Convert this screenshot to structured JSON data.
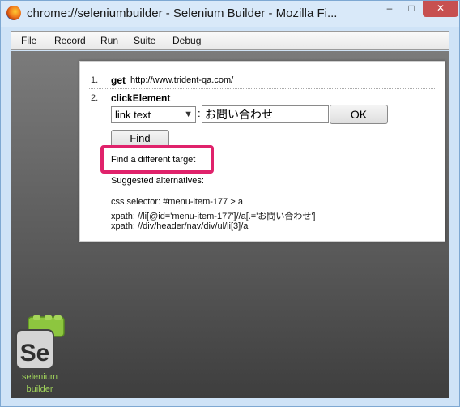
{
  "window": {
    "title": "chrome://seleniumbuilder - Selenium Builder - Mozilla Fi...",
    "controls": {
      "minimize": "–",
      "maximize": "□",
      "close": "✕"
    }
  },
  "menu": [
    "File",
    "Record",
    "Run",
    "Suite",
    "Debug"
  ],
  "steps": [
    {
      "num": "1.",
      "command": "get",
      "arg": "http://www.trident-qa.com/"
    },
    {
      "num": "2.",
      "command": "clickElement"
    }
  ],
  "locator": {
    "type_selected": "link text",
    "value": "お問い合わせ",
    "colon": ":",
    "ok_label": "OK",
    "find_label": "Find",
    "different_target_label": "Find a different target",
    "suggested_heading": "Suggested alternatives:",
    "alternatives": [
      "css selector: #menu-item-177 > a",
      "xpath: //li[@id='menu-item-177']//a[.='お問い合わせ']",
      "xpath: //div/header/nav/div/ul/li[3]/a"
    ]
  },
  "app": {
    "logo_text": "Se",
    "caption_line1": "selenium",
    "caption_line2": "builder"
  },
  "colors": {
    "highlight": "#e0226b",
    "accent_green": "#7cc242"
  }
}
